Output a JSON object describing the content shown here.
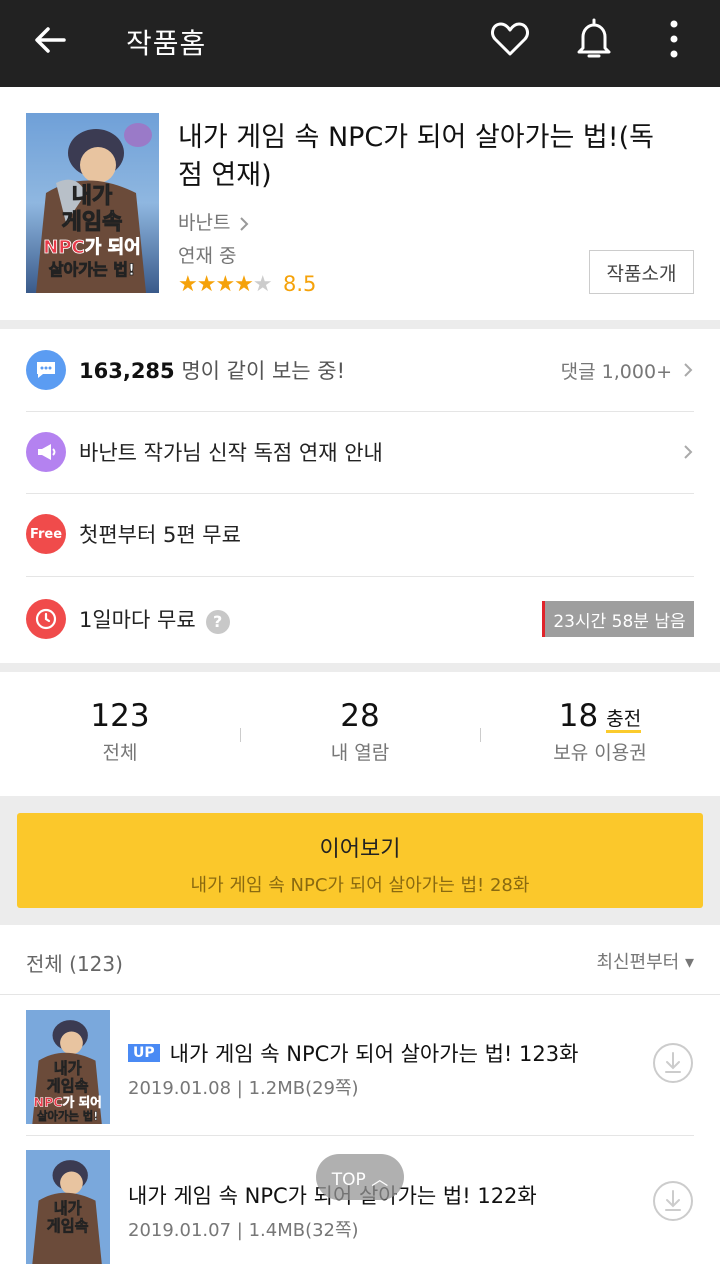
{
  "topbar": {
    "title": "작품홈",
    "icons": [
      "back-arrow-icon",
      "heart-icon",
      "bell-icon",
      "more-icon"
    ]
  },
  "work": {
    "title": "내가 게임 속 NPC가 되어 살아가는 법!(독점 연재)",
    "author": "바난트",
    "status": "연재 중",
    "stars_full": 4,
    "stars_total": 5,
    "rating": "8.5",
    "intro_button": "작품소개",
    "cover_text_1": "내가",
    "cover_text_2": "게임속",
    "cover_text_3": "NPC가 되어",
    "cover_text_4": "살아가는 법!"
  },
  "rows": {
    "viewers_count": "163,285",
    "viewers_text": " 명이 같이 보는 중!",
    "comments": "댓글 1,000+",
    "notice": "바난트 작가님 신작 독점 연재 안내",
    "free_badge": "Free",
    "free_text": "첫편부터 5편 무료",
    "daily_text": "1일마다 무료",
    "help": "?",
    "timer": "23시간 58분 남음"
  },
  "counts": {
    "total_num": "123",
    "total_label": "전체",
    "read_num": "28",
    "read_label": "내 열람",
    "owned_num": "18",
    "charge_label": "충전",
    "owned_label": "보유 이용권"
  },
  "continue": {
    "label": "이어보기",
    "subtitle": "내가 게임 속 NPC가 되어 살아가는 법! 28화"
  },
  "list": {
    "total": "전체 (123)",
    "sort": "최신편부터 ▾",
    "episodes": [
      {
        "badge": "UP",
        "title": "내가 게임 속 NPC가 되어 살아가는 법! 123화",
        "meta": "2019.01.08 | 1.2MB(29쪽)"
      },
      {
        "badge": "",
        "title": "내가 게임 속 NPC가 되어 살아가는 법! 122화",
        "meta": "2019.01.07 | 1.4MB(32쪽)"
      }
    ]
  },
  "top_button": "TOP ︿",
  "colors": {
    "accent": "#fbc82b",
    "star": "#f5a20a",
    "topbar": "#222222"
  }
}
